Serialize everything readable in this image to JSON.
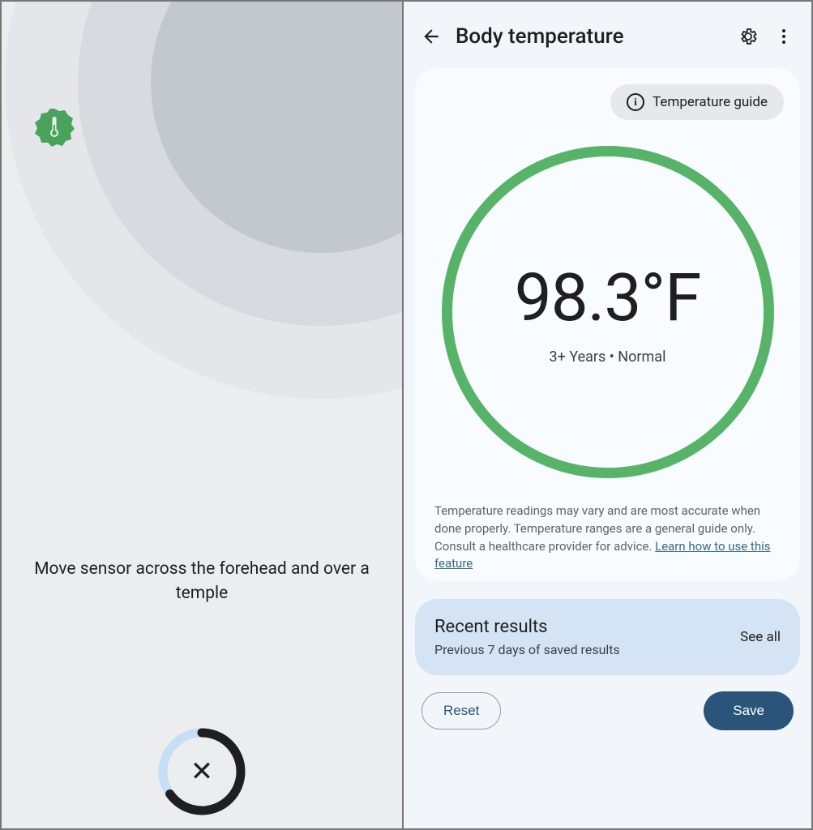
{
  "left": {
    "instruction": "Move sensor across the forehead and over a temple",
    "close_icon": "close-icon"
  },
  "right": {
    "header": {
      "title": "Body temperature"
    },
    "guide_chip": "Temperature guide",
    "reading": {
      "value": "98.3°F",
      "subtitle": "3+ Years • Normal"
    },
    "disclaimer": {
      "text": "Temperature readings may vary and are most accurate when done properly. Temperature ranges are a general guide only. Consult a healthcare provider for advice. ",
      "link": "Learn how to use this feature"
    },
    "recent": {
      "title": "Recent results",
      "subtitle": "Previous 7 days of saved results",
      "see_all": "See all"
    },
    "buttons": {
      "reset": "Reset",
      "save": "Save"
    },
    "colors": {
      "ring": "#57b368",
      "primary": "#2b547a"
    }
  }
}
